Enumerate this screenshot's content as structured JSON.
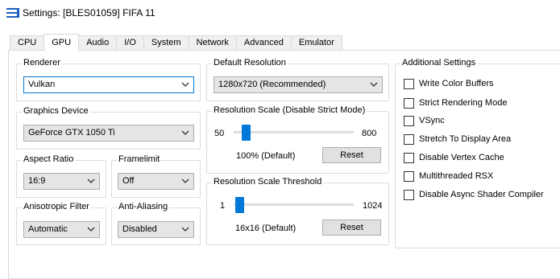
{
  "window": {
    "title": "Settings: [BLES01059] FIFA 11"
  },
  "tabs": [
    {
      "label": "CPU"
    },
    {
      "label": "GPU"
    },
    {
      "label": "Audio"
    },
    {
      "label": "I/O"
    },
    {
      "label": "System"
    },
    {
      "label": "Network"
    },
    {
      "label": "Advanced"
    },
    {
      "label": "Emulator"
    }
  ],
  "active_tab": "GPU",
  "renderer": {
    "title": "Renderer",
    "value": "Vulkan"
  },
  "graphics_device": {
    "title": "Graphics Device",
    "value": "GeForce GTX 1050 Ti"
  },
  "aspect_ratio": {
    "title": "Aspect Ratio",
    "value": "16:9"
  },
  "framelimit": {
    "title": "Framelimit",
    "value": "Off"
  },
  "anisotropic_filter": {
    "title": "Anisotropic Filter",
    "value": "Automatic"
  },
  "anti_aliasing": {
    "title": "Anti-Aliasing",
    "value": "Disabled"
  },
  "default_resolution": {
    "title": "Default Resolution",
    "value": "1280x720 (Recommended)"
  },
  "resolution_scale": {
    "title": "Resolution Scale (Disable Strict Mode)",
    "min": "50",
    "max": "800",
    "value": 100,
    "value_text": "100% (Default)",
    "reset_label": "Reset"
  },
  "resolution_scale_threshold": {
    "title": "Resolution Scale Threshold",
    "min": "1",
    "max": "1024",
    "value": 16,
    "value_text": "16x16 (Default)",
    "reset_label": "Reset"
  },
  "additional_settings": {
    "title": "Additional Settings",
    "items": [
      {
        "label": "Write Color Buffers",
        "checked": false
      },
      {
        "label": "Strict Rendering Mode",
        "checked": false
      },
      {
        "label": "VSync",
        "checked": false
      },
      {
        "label": "Stretch To Display Area",
        "checked": false
      },
      {
        "label": "Disable Vertex Cache",
        "checked": false
      },
      {
        "label": "Multithreaded RSX",
        "checked": false
      },
      {
        "label": "Disable Async Shader Compiler",
        "checked": false
      }
    ]
  },
  "colors": {
    "accent": "#0078d7"
  }
}
